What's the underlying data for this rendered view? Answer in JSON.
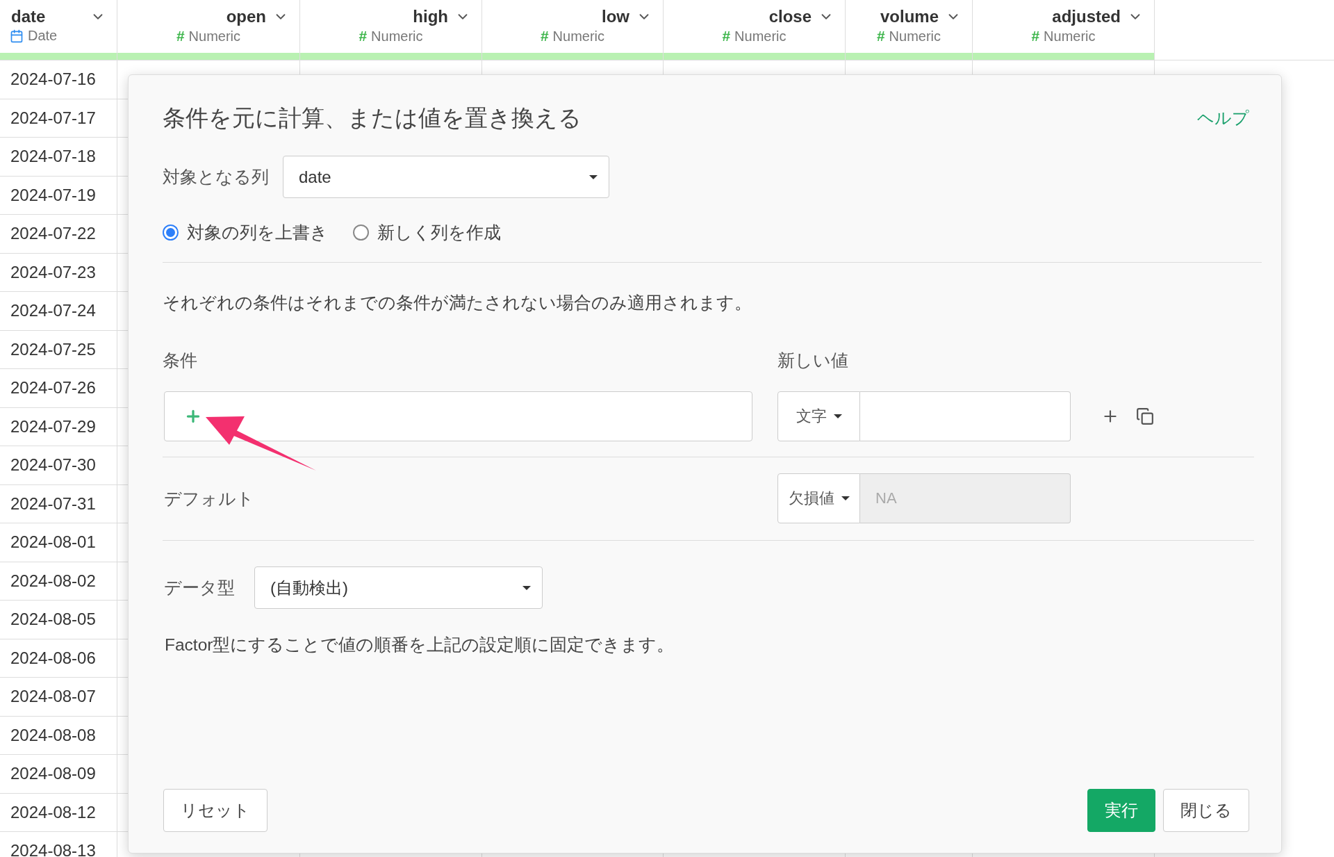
{
  "table": {
    "columns": [
      {
        "name": "date",
        "kind": "date",
        "type": "Date"
      },
      {
        "name": "open",
        "kind": "numeric",
        "symbol": "#",
        "type": "Numeric"
      },
      {
        "name": "high",
        "kind": "numeric",
        "symbol": "#",
        "type": "Numeric"
      },
      {
        "name": "low",
        "kind": "numeric",
        "symbol": "#",
        "type": "Numeric"
      },
      {
        "name": "close",
        "kind": "numeric",
        "symbol": "#",
        "type": "Numeric"
      },
      {
        "name": "volume",
        "kind": "numeric",
        "symbol": "#",
        "type": "Numeric"
      },
      {
        "name": "adjusted",
        "kind": "numeric",
        "symbol": "#",
        "type": "Numeric"
      }
    ],
    "rows": [
      {
        "date": "2024-07-16"
      },
      {
        "date": "2024-07-17"
      },
      {
        "date": "2024-07-18"
      },
      {
        "date": "2024-07-19"
      },
      {
        "date": "2024-07-22"
      },
      {
        "date": "2024-07-23"
      },
      {
        "date": "2024-07-24"
      },
      {
        "date": "2024-07-25"
      },
      {
        "date": "2024-07-26"
      },
      {
        "date": "2024-07-29"
      },
      {
        "date": "2024-07-30"
      },
      {
        "date": "2024-07-31"
      },
      {
        "date": "2024-08-01"
      },
      {
        "date": "2024-08-02"
      },
      {
        "date": "2024-08-05"
      },
      {
        "date": "2024-08-06"
      },
      {
        "date": "2024-08-07"
      },
      {
        "date": "2024-08-08"
      },
      {
        "date": "2024-08-09"
      },
      {
        "date": "2024-08-12"
      },
      {
        "date": "2024-08-13"
      }
    ]
  },
  "dialog": {
    "title": "条件を元に計算、または値を置き換える",
    "help": "ヘルプ",
    "target_column": {
      "label": "対象となる列",
      "value": "date"
    },
    "modes": [
      {
        "label": "対象の列を上書き",
        "selected": true
      },
      {
        "label": "新しく列を作成",
        "selected": false
      }
    ],
    "note": "それぞれの条件はそれまでの条件が満たされない場合のみ適用されます。",
    "conditions": {
      "label": "条件",
      "new_value_label": "新しい値",
      "rows": [
        {
          "value_type": "文字"
        }
      ]
    },
    "default": {
      "label": "デフォルト",
      "value_type": "欠損値",
      "placeholder": "NA"
    },
    "data_type": {
      "label": "データ型",
      "value": "(自動検出)"
    },
    "factor_note": "Factor型にすることで値の順番を上記の設定順に固定できます。",
    "buttons": {
      "reset": "リセット",
      "run": "実行",
      "close": "閉じる"
    }
  }
}
